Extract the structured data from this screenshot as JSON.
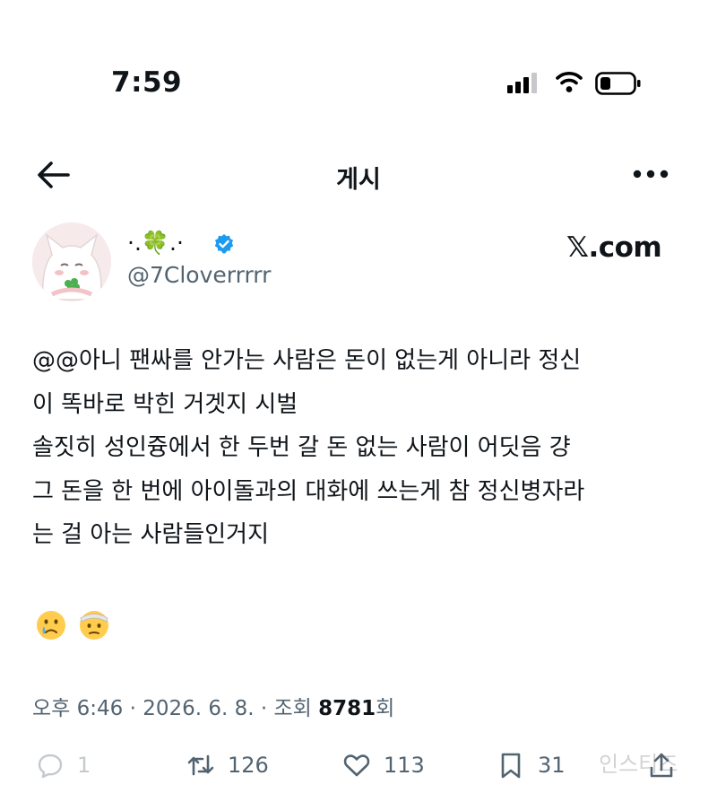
{
  "status_bar": {
    "time": "7:59"
  },
  "nav": {
    "title": "게시"
  },
  "author": {
    "display_name_prefix": "·.",
    "display_name_clover": "🍀",
    "display_name_suffix": ".·",
    "handle": "@7Cloverrrrr",
    "verified": true
  },
  "source": "𝕏.com",
  "post": {
    "text": "@@아니 팬싸를 안가는 사람은 돈이 없는게 아니라 정신\n이 똑바로 박힌 거겟지 시벌\n솔짓히 성인즁에서 한 두번 갈 돈 없는 사람이 어딧음 걍\n그 돈을 한 번에 아이돌과의 대화에 쓰는게 참 정신병자라\n는 걸 아는 사람들인거지",
    "emojis": [
      "crying-face",
      "face-with-bandage"
    ]
  },
  "meta": {
    "time": "오후 6:46",
    "date": "2026. 6. 8.",
    "separator": "·",
    "views_label": "조회",
    "views_count": "8781",
    "views_suffix": "회"
  },
  "actions": {
    "replies": "1",
    "reposts": "126",
    "likes": "113",
    "bookmarks": "31"
  },
  "watermark": "인스티즈"
}
